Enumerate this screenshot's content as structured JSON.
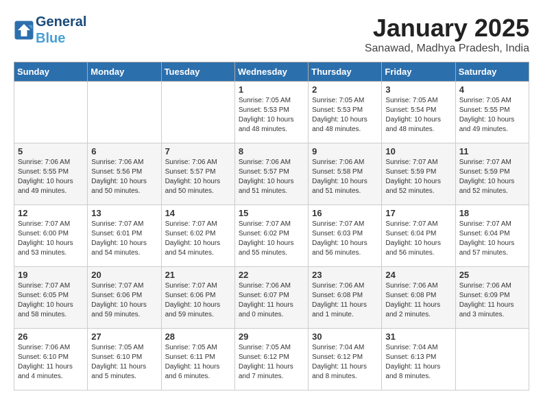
{
  "header": {
    "logo_line1": "General",
    "logo_line2": "Blue",
    "title": "January 2025",
    "subtitle": "Sanawad, Madhya Pradesh, India"
  },
  "weekdays": [
    "Sunday",
    "Monday",
    "Tuesday",
    "Wednesday",
    "Thursday",
    "Friday",
    "Saturday"
  ],
  "weeks": [
    [
      {
        "day": "",
        "info": ""
      },
      {
        "day": "",
        "info": ""
      },
      {
        "day": "",
        "info": ""
      },
      {
        "day": "1",
        "info": "Sunrise: 7:05 AM\nSunset: 5:53 PM\nDaylight: 10 hours\nand 48 minutes."
      },
      {
        "day": "2",
        "info": "Sunrise: 7:05 AM\nSunset: 5:53 PM\nDaylight: 10 hours\nand 48 minutes."
      },
      {
        "day": "3",
        "info": "Sunrise: 7:05 AM\nSunset: 5:54 PM\nDaylight: 10 hours\nand 48 minutes."
      },
      {
        "day": "4",
        "info": "Sunrise: 7:05 AM\nSunset: 5:55 PM\nDaylight: 10 hours\nand 49 minutes."
      }
    ],
    [
      {
        "day": "5",
        "info": "Sunrise: 7:06 AM\nSunset: 5:55 PM\nDaylight: 10 hours\nand 49 minutes."
      },
      {
        "day": "6",
        "info": "Sunrise: 7:06 AM\nSunset: 5:56 PM\nDaylight: 10 hours\nand 50 minutes."
      },
      {
        "day": "7",
        "info": "Sunrise: 7:06 AM\nSunset: 5:57 PM\nDaylight: 10 hours\nand 50 minutes."
      },
      {
        "day": "8",
        "info": "Sunrise: 7:06 AM\nSunset: 5:57 PM\nDaylight: 10 hours\nand 51 minutes."
      },
      {
        "day": "9",
        "info": "Sunrise: 7:06 AM\nSunset: 5:58 PM\nDaylight: 10 hours\nand 51 minutes."
      },
      {
        "day": "10",
        "info": "Sunrise: 7:07 AM\nSunset: 5:59 PM\nDaylight: 10 hours\nand 52 minutes."
      },
      {
        "day": "11",
        "info": "Sunrise: 7:07 AM\nSunset: 5:59 PM\nDaylight: 10 hours\nand 52 minutes."
      }
    ],
    [
      {
        "day": "12",
        "info": "Sunrise: 7:07 AM\nSunset: 6:00 PM\nDaylight: 10 hours\nand 53 minutes."
      },
      {
        "day": "13",
        "info": "Sunrise: 7:07 AM\nSunset: 6:01 PM\nDaylight: 10 hours\nand 54 minutes."
      },
      {
        "day": "14",
        "info": "Sunrise: 7:07 AM\nSunset: 6:02 PM\nDaylight: 10 hours\nand 54 minutes."
      },
      {
        "day": "15",
        "info": "Sunrise: 7:07 AM\nSunset: 6:02 PM\nDaylight: 10 hours\nand 55 minutes."
      },
      {
        "day": "16",
        "info": "Sunrise: 7:07 AM\nSunset: 6:03 PM\nDaylight: 10 hours\nand 56 minutes."
      },
      {
        "day": "17",
        "info": "Sunrise: 7:07 AM\nSunset: 6:04 PM\nDaylight: 10 hours\nand 56 minutes."
      },
      {
        "day": "18",
        "info": "Sunrise: 7:07 AM\nSunset: 6:04 PM\nDaylight: 10 hours\nand 57 minutes."
      }
    ],
    [
      {
        "day": "19",
        "info": "Sunrise: 7:07 AM\nSunset: 6:05 PM\nDaylight: 10 hours\nand 58 minutes."
      },
      {
        "day": "20",
        "info": "Sunrise: 7:07 AM\nSunset: 6:06 PM\nDaylight: 10 hours\nand 59 minutes."
      },
      {
        "day": "21",
        "info": "Sunrise: 7:07 AM\nSunset: 6:06 PM\nDaylight: 10 hours\nand 59 minutes."
      },
      {
        "day": "22",
        "info": "Sunrise: 7:06 AM\nSunset: 6:07 PM\nDaylight: 11 hours\nand 0 minutes."
      },
      {
        "day": "23",
        "info": "Sunrise: 7:06 AM\nSunset: 6:08 PM\nDaylight: 11 hours\nand 1 minute."
      },
      {
        "day": "24",
        "info": "Sunrise: 7:06 AM\nSunset: 6:08 PM\nDaylight: 11 hours\nand 2 minutes."
      },
      {
        "day": "25",
        "info": "Sunrise: 7:06 AM\nSunset: 6:09 PM\nDaylight: 11 hours\nand 3 minutes."
      }
    ],
    [
      {
        "day": "26",
        "info": "Sunrise: 7:06 AM\nSunset: 6:10 PM\nDaylight: 11 hours\nand 4 minutes."
      },
      {
        "day": "27",
        "info": "Sunrise: 7:05 AM\nSunset: 6:10 PM\nDaylight: 11 hours\nand 5 minutes."
      },
      {
        "day": "28",
        "info": "Sunrise: 7:05 AM\nSunset: 6:11 PM\nDaylight: 11 hours\nand 6 minutes."
      },
      {
        "day": "29",
        "info": "Sunrise: 7:05 AM\nSunset: 6:12 PM\nDaylight: 11 hours\nand 7 minutes."
      },
      {
        "day": "30",
        "info": "Sunrise: 7:04 AM\nSunset: 6:12 PM\nDaylight: 11 hours\nand 8 minutes."
      },
      {
        "day": "31",
        "info": "Sunrise: 7:04 AM\nSunset: 6:13 PM\nDaylight: 11 hours\nand 8 minutes."
      },
      {
        "day": "",
        "info": ""
      }
    ]
  ]
}
